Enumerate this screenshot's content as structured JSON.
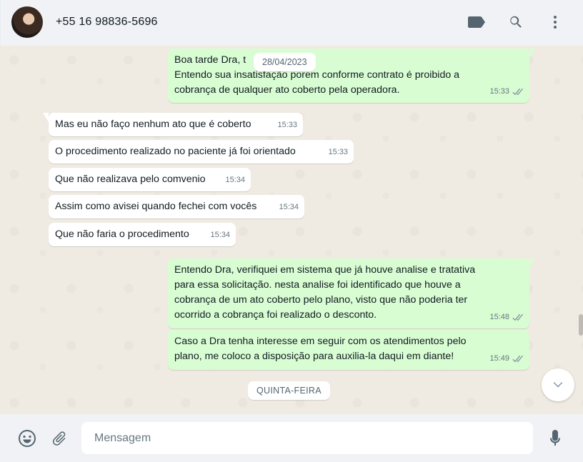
{
  "header": {
    "contact_name": "+55 16 98836-5696",
    "icons": [
      "label-icon",
      "search-icon",
      "menu-icon"
    ]
  },
  "chat": {
    "floating_date": "28/04/2023",
    "messages": [
      {
        "direction": "out",
        "lines": [
          "Boa tarde Dra, t",
          "Entendo sua insatisfação porem conforme contrato é proibido a",
          "cobrança de qualquer ato coberto pela operadora."
        ],
        "time": "15:33",
        "status": "read"
      },
      {
        "direction": "in",
        "lines": [
          "Mas eu não faço nenhum ato que é coberto"
        ],
        "time": "15:33"
      },
      {
        "direction": "in",
        "lines": [
          "O procedimento realizado no paciente já foi orientado"
        ],
        "time": "15:33"
      },
      {
        "direction": "in",
        "lines": [
          "Que não realizava pelo comvenio"
        ],
        "time": "15:34"
      },
      {
        "direction": "in",
        "lines": [
          "Assim como avisei quando fechei com vocês"
        ],
        "time": "15:34"
      },
      {
        "direction": "in",
        "lines": [
          "Que não faria o procedimento"
        ],
        "time": "15:34"
      },
      {
        "direction": "out",
        "lines": [
          "Entendo Dra, verifiquei em sistema que já houve analise e tratativa",
          "para essa solicitação. nesta analise foi identificado que houve a",
          "cobrança de um ato coberto pelo plano, visto que não poderia ter",
          "ocorrido a cobrança foi realizado o desconto."
        ],
        "time": "15:48",
        "status": "read"
      },
      {
        "direction": "out",
        "lines": [
          "Caso a Dra tenha interesse em seguir com os atendimentos pelo",
          "plano, me coloco a disposição para auxilia-la daqui em diante!"
        ],
        "time": "15:49",
        "status": "read"
      }
    ],
    "day_separator": "QUINTA-FEIRA"
  },
  "footer": {
    "placeholder": "Mensagem",
    "icons": [
      "emoji-icon",
      "attach-icon",
      "microphone-icon"
    ]
  },
  "colors": {
    "outgoing_bubble": "#d9fdd3",
    "incoming_bubble": "#ffffff",
    "chat_background": "#efeae2",
    "bars": "#f0f2f5"
  }
}
